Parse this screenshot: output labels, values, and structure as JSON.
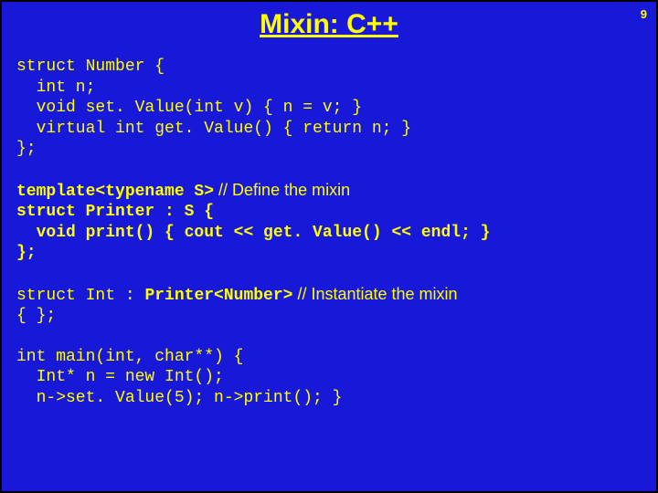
{
  "page_number": "9",
  "title": "Mixin: C++",
  "block1": {
    "l1": "struct Number {",
    "l2": "  int n;",
    "l3": "  void set. Value(int v) { n = v; }",
    "l4": "  virtual int get. Value() { return n; }",
    "l5": "};"
  },
  "block2": {
    "l1a": "template<typename S>",
    "l1b": " // Define the mixin",
    "l2": "struct Printer : S {",
    "l3": "  void print() { cout << get. Value() << endl; }",
    "l4": "};"
  },
  "block3": {
    "l1a": "struct Int : ",
    "l1b": "Printer<Number>",
    "l1c": " // Instantiate the mixin",
    "l2": "{ };"
  },
  "block4": {
    "l1": "int main(int, char**) {",
    "l2": "  Int* n = new Int();",
    "l3": "  n->set. Value(5); n->print(); }"
  }
}
